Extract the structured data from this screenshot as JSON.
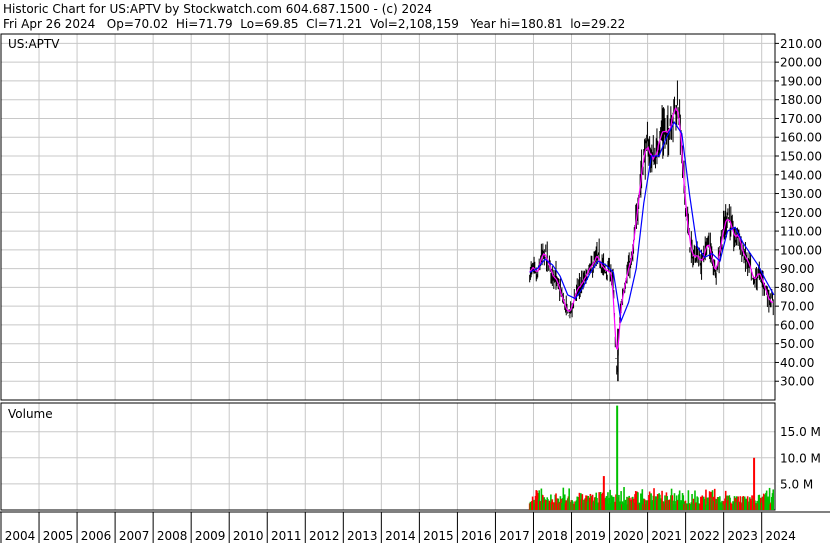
{
  "header": {
    "line1": "Historic Chart for US:APTV by Stockwatch.com 604.687.1500 - (c) 2024",
    "line2": "Fri Apr 26 2024   Op=70.02  Hi=71.79  Lo=69.85  Cl=71.21  Vol=2,108,159   Year hi=180.81  lo=29.22"
  },
  "chart_data": [
    {
      "type": "candlestick",
      "label": "US:APTV",
      "ylim": [
        20,
        215
      ],
      "yticks": [
        30,
        40,
        50,
        60,
        70,
        80,
        90,
        100,
        110,
        120,
        130,
        140,
        150,
        160,
        170,
        180,
        190,
        200,
        210
      ],
      "ytick_labels": [
        "30.00",
        "40.00",
        "50.00",
        "60.00",
        "70.00",
        "80.00",
        "90.00",
        "100.00",
        "110.00",
        "120.00",
        "130.00",
        "140.00",
        "150.00",
        "160.00",
        "170.00",
        "180.00",
        "190.00",
        "200.00",
        "210.00"
      ],
      "x_range": [
        2004,
        2024.35
      ],
      "x_labels": [
        "2004",
        "2005",
        "2006",
        "2007",
        "2008",
        "2009",
        "2010",
        "2011",
        "2012",
        "2013",
        "2014",
        "2015",
        "2016",
        "2017",
        "2018",
        "2019",
        "2020",
        "2021",
        "2022",
        "2023",
        "2024"
      ],
      "colors": {
        "price": "#000000",
        "ma_short": "#ff00ff",
        "ma_long": "#0000ff",
        "grid": "#c8c8c8"
      },
      "series": [
        {
          "x": [
            2017.9,
            2018.0,
            2018.1,
            2018.2,
            2018.3,
            2018.4,
            2018.5,
            2018.6,
            2018.7,
            2018.8,
            2018.9,
            2019.0,
            2019.1,
            2019.2,
            2019.3,
            2019.4,
            2019.5,
            2019.6,
            2019.7,
            2019.8,
            2019.9,
            2020.0,
            2020.1,
            2020.15,
            2020.2,
            2020.25,
            2020.3,
            2020.4,
            2020.5,
            2020.6,
            2020.7,
            2020.8,
            2020.9,
            2021.0,
            2021.1,
            2021.2,
            2021.3,
            2021.4,
            2021.5,
            2021.6,
            2021.7,
            2021.8,
            2021.85,
            2021.9,
            2022.0,
            2022.1,
            2022.2,
            2022.3,
            2022.4,
            2022.5,
            2022.6,
            2022.7,
            2022.8,
            2022.9,
            2023.0,
            2023.1,
            2023.2,
            2023.3,
            2023.4,
            2023.5,
            2023.6,
            2023.7,
            2023.8,
            2023.9,
            2024.0,
            2024.1,
            2024.2,
            2024.32
          ],
          "close": [
            87,
            90,
            85,
            95,
            98,
            92,
            88,
            84,
            78,
            72,
            66,
            68,
            76,
            80,
            82,
            86,
            90,
            93,
            96,
            92,
            88,
            90,
            82,
            50,
            32,
            58,
            70,
            82,
            90,
            95,
            115,
            135,
            150,
            155,
            150,
            148,
            158,
            165,
            160,
            168,
            175,
            176,
            170,
            150,
            125,
            105,
            95,
            100,
            92,
            98,
            105,
            95,
            88,
            100,
            110,
            120,
            112,
            105,
            110,
            98,
            95,
            90,
            82,
            88,
            85,
            80,
            74,
            71
          ]
        },
        {
          "x": [
            2017.9,
            2018.1,
            2018.3,
            2018.5,
            2018.7,
            2018.9,
            2019.1,
            2019.3,
            2019.5,
            2019.7,
            2019.9,
            2020.1,
            2020.3,
            2020.5,
            2020.7,
            2020.9,
            2021.1,
            2021.3,
            2021.5,
            2021.7,
            2021.9,
            2022.1,
            2022.3,
            2022.5,
            2022.7,
            2022.9,
            2023.1,
            2023.3,
            2023.5,
            2023.7,
            2023.9,
            2024.1,
            2024.32
          ],
          "ma_long": [
            88,
            90,
            95,
            92,
            86,
            76,
            74,
            80,
            88,
            94,
            92,
            88,
            62,
            72,
            90,
            125,
            150,
            150,
            160,
            168,
            162,
            130,
            102,
            96,
            98,
            94,
            110,
            112,
            104,
            98,
            92,
            84,
            76
          ]
        }
      ]
    },
    {
      "type": "bar",
      "label": "Volume",
      "unit": "M",
      "ylim": [
        0,
        20.5
      ],
      "yticks": [
        5,
        10,
        15
      ],
      "ytick_labels": [
        "5.0 M",
        "10.0 M",
        "15.0 M"
      ],
      "colors": {
        "up": "#00c000",
        "down": "#ff0000"
      },
      "peak_values": [
        {
          "x": 2020.2,
          "value": 20.0
        },
        {
          "x": 2023.8,
          "value": 10.0
        },
        {
          "x": 2019.85,
          "value": 6.5
        }
      ],
      "baseline_range": [
        1.0,
        4.5
      ]
    }
  ]
}
